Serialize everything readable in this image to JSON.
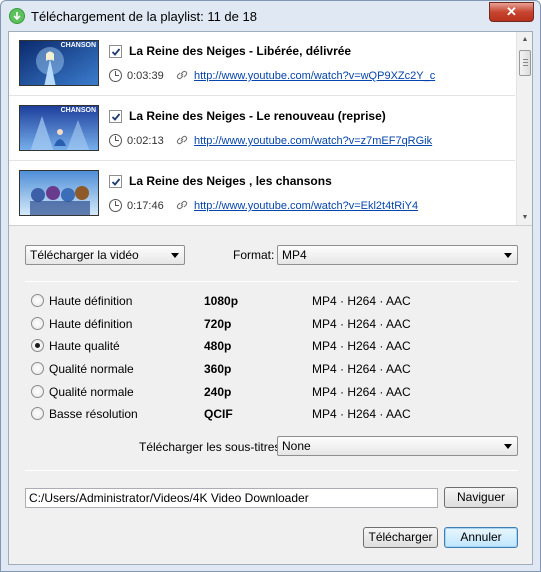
{
  "window": {
    "title": "Téléchargement de la playlist: 11 de 18",
    "close_glyph": "✕"
  },
  "videos": [
    {
      "thumb_tag": "CHANSON",
      "checked": true,
      "title": "La Reine des Neiges - Libérée, délivrée",
      "duration": "0:03:39",
      "url": "http://www.youtube.com/watch?v=wQP9XZc2Y_c"
    },
    {
      "thumb_tag": "CHANSON",
      "checked": true,
      "title": "La Reine des Neiges - Le renouveau (reprise)",
      "duration": "0:02:13",
      "url": "http://www.youtube.com/watch?v=z7mEF7qRGik"
    },
    {
      "thumb_tag": "",
      "checked": true,
      "title": "La Reine des Neiges , les chansons",
      "duration": "0:17:46",
      "url": "http://www.youtube.com/watch?v=Ekl2t4tRiY4"
    }
  ],
  "action_select": {
    "value": "Télécharger la vidéo"
  },
  "format": {
    "label": "Format:",
    "value": "MP4"
  },
  "qualities": [
    {
      "label": "Haute définition",
      "resolution": "1080p",
      "codecs": "MP4 · H264 · AAC",
      "selected": false
    },
    {
      "label": "Haute définition",
      "resolution": "720p",
      "codecs": "MP4 · H264 · AAC",
      "selected": false
    },
    {
      "label": "Haute qualité",
      "resolution": "480p",
      "codecs": "MP4 · H264 · AAC",
      "selected": true
    },
    {
      "label": "Qualité normale",
      "resolution": "360p",
      "codecs": "MP4 · H264 · AAC",
      "selected": false
    },
    {
      "label": "Qualité normale",
      "resolution": "240p",
      "codecs": "MP4 · H264 · AAC",
      "selected": false
    },
    {
      "label": "Basse résolution",
      "resolution": "QCIF",
      "codecs": "MP4 · H264 · AAC",
      "selected": false
    }
  ],
  "subtitles": {
    "label": "Télécharger les sous-titres:",
    "value": "None"
  },
  "path": {
    "value": "C:/Users/Administrator/Videos/4K Video Downloader"
  },
  "buttons": {
    "browse": "Naviguer",
    "download": "Télécharger",
    "cancel": "Annuler"
  },
  "colors": {
    "link": "#0645ad",
    "window_frame": "#dfe8f3",
    "dialog_bg": "#f0f0f0"
  }
}
